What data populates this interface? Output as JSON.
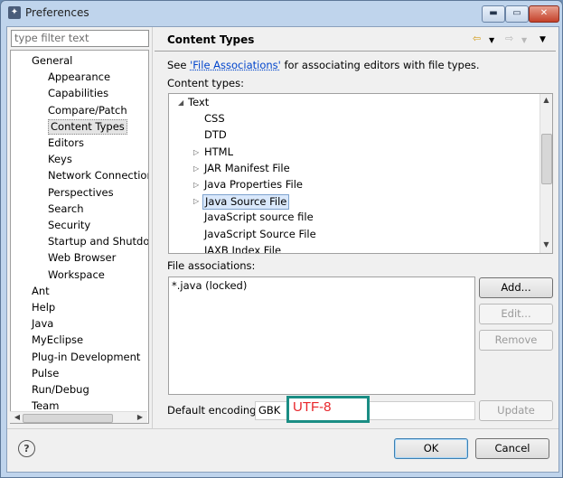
{
  "window": {
    "title": "Preferences",
    "title_icon": "app-icon",
    "min_label": "▬",
    "max_label": "▭",
    "close_label": "✕"
  },
  "filter": {
    "placeholder": "type filter text"
  },
  "tree": {
    "items": [
      {
        "label": "General",
        "level": 0
      },
      {
        "label": "Appearance",
        "level": 1
      },
      {
        "label": "Capabilities",
        "level": 1
      },
      {
        "label": "Compare/Patch",
        "level": 1
      },
      {
        "label": "Content Types",
        "level": 1,
        "selected": true
      },
      {
        "label": "Editors",
        "level": 1
      },
      {
        "label": "Keys",
        "level": 1
      },
      {
        "label": "Network Connections",
        "level": 1
      },
      {
        "label": "Perspectives",
        "level": 1
      },
      {
        "label": "Search",
        "level": 1
      },
      {
        "label": "Security",
        "level": 1
      },
      {
        "label": "Startup and Shutdown",
        "level": 1
      },
      {
        "label": "Web Browser",
        "level": 1
      },
      {
        "label": "Workspace",
        "level": 1
      },
      {
        "label": "Ant",
        "level": 0
      },
      {
        "label": "Help",
        "level": 0
      },
      {
        "label": "Java",
        "level": 0
      },
      {
        "label": "MyEclipse",
        "level": 0
      },
      {
        "label": "Plug-in Development",
        "level": 0
      },
      {
        "label": "Pulse",
        "level": 0
      },
      {
        "label": "Run/Debug",
        "level": 0
      },
      {
        "label": "Team",
        "level": 0
      }
    ]
  },
  "page": {
    "title": "Content Types",
    "see_prefix": "See ",
    "see_link": "'File Associations'",
    "see_suffix": " for associating editors with file types.",
    "content_types_label": "Content types:",
    "file_assoc_label": "File associations:",
    "default_encoding_label": "Default encoding:",
    "encoding_value": "GBK",
    "annotation_text": "UTF-8"
  },
  "content_types": {
    "items": [
      {
        "label": "Text",
        "expander": "expanded"
      },
      {
        "label": "CSS",
        "expander": "none"
      },
      {
        "label": "DTD",
        "expander": "none"
      },
      {
        "label": "HTML",
        "expander": "collapsed"
      },
      {
        "label": "JAR Manifest File",
        "expander": "collapsed"
      },
      {
        "label": "Java Properties File",
        "expander": "collapsed"
      },
      {
        "label": "Java Source File",
        "expander": "collapsed",
        "selected": true
      },
      {
        "label": "JavaScript source file",
        "expander": "none"
      },
      {
        "label": "JavaScript Source File",
        "expander": "none"
      },
      {
        "label": "JAXB Index File",
        "expander": "none"
      }
    ]
  },
  "file_associations": [
    "*.java (locked)"
  ],
  "buttons": {
    "add": "Add...",
    "edit": "Edit...",
    "remove": "Remove",
    "update": "Update",
    "ok": "OK",
    "cancel": "Cancel",
    "help": "?"
  },
  "nav_icons": [
    "back-arrow-icon",
    "dropdown-icon",
    "forward-arrow-icon",
    "dropdown-icon",
    "view-menu-icon"
  ]
}
